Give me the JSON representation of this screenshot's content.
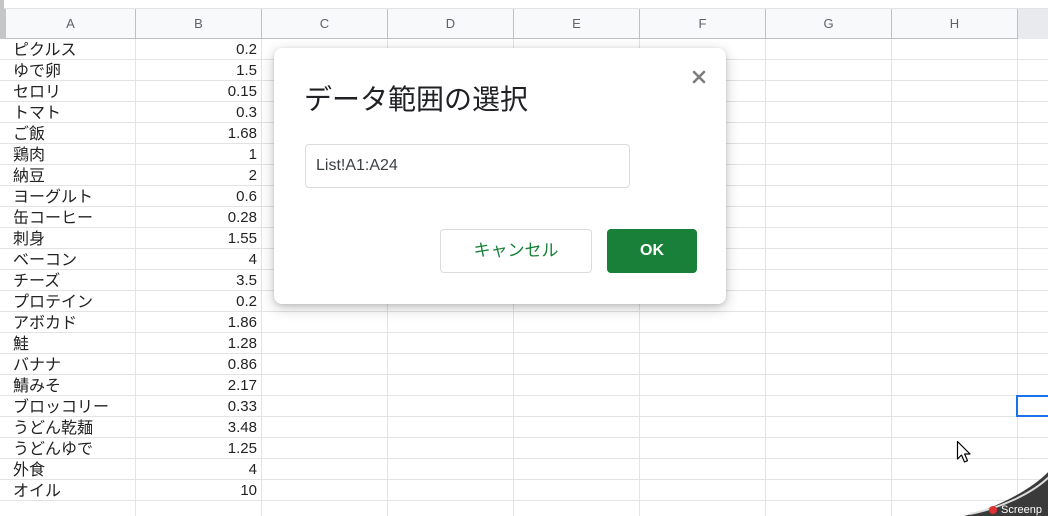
{
  "spreadsheet": {
    "columns": [
      "A",
      "B",
      "C",
      "D",
      "E",
      "F",
      "G",
      "H"
    ],
    "rows": [
      {
        "name": "ピクルス",
        "value": "0.2"
      },
      {
        "name": "ゆで卵",
        "value": "1.5"
      },
      {
        "name": "セロリ",
        "value": "0.15"
      },
      {
        "name": "トマト",
        "value": "0.3"
      },
      {
        "name": "ご飯",
        "value": "1.68"
      },
      {
        "name": "鶏肉",
        "value": "1"
      },
      {
        "name": "納豆",
        "value": "2"
      },
      {
        "name": "ヨーグルト",
        "value": "0.6"
      },
      {
        "name": "缶コーヒー",
        "value": "0.28"
      },
      {
        "name": "刺身",
        "value": "1.55"
      },
      {
        "name": "ベーコン",
        "value": "4"
      },
      {
        "name": "チーズ",
        "value": "3.5"
      },
      {
        "name": "プロテイン",
        "value": "0.2"
      },
      {
        "name": "アボカド",
        "value": "1.86"
      },
      {
        "name": "鮭",
        "value": "1.28"
      },
      {
        "name": "バナナ",
        "value": "0.86"
      },
      {
        "name": "鯖みそ",
        "value": "2.17"
      },
      {
        "name": "ブロッコリー",
        "value": "0.33"
      },
      {
        "name": "うどん乾麺",
        "value": "3.48"
      },
      {
        "name": "うどんゆで",
        "value": "1.25"
      },
      {
        "name": "外食",
        "value": "4"
      },
      {
        "name": "オイル",
        "value": "10"
      }
    ]
  },
  "dialog": {
    "title": "データ範囲の選択",
    "range_value": "List!A1:A24",
    "cancel_label": "キャンセル",
    "ok_label": "OK",
    "close_icon": "close-icon"
  },
  "overlay": {
    "corner_label": "Screenp"
  },
  "colors": {
    "accent_green": "#188038",
    "selection_blue": "#1a73e8",
    "header_bg": "#f8f9fa",
    "gridline": "#e2e3e3"
  }
}
